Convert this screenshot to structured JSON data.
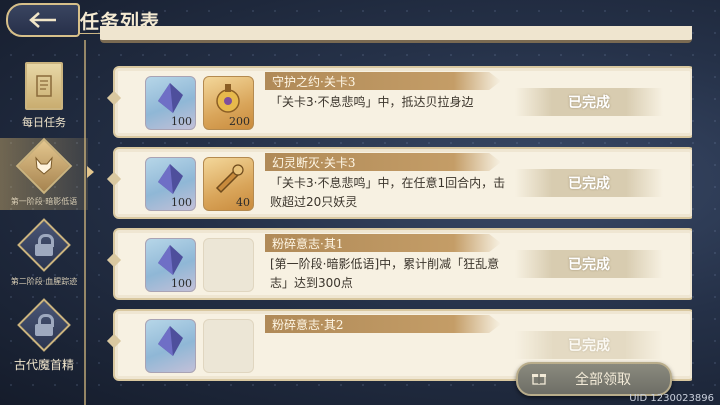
{
  "header": {
    "title": "任务列表"
  },
  "sidebar": {
    "tabs": [
      {
        "label": "每日任务",
        "state": "normal"
      },
      {
        "label": "第一阶段·暗影低语",
        "state": "active"
      },
      {
        "label": "第二阶段·血腥踪迹",
        "state": "locked"
      },
      {
        "label": "古代魔首精",
        "state": "locked"
      }
    ]
  },
  "tasks": [
    {
      "title": "守护之约·关卡3",
      "description": "「关卡3·不息悲鸣」中，抵达贝拉身边",
      "status": "已完成",
      "rewards": [
        {
          "icon": "crystal-icon",
          "qty": "100"
        },
        {
          "icon": "potion-icon",
          "qty": "200"
        }
      ]
    },
    {
      "title": "幻灵断灭·关卡3",
      "description": "「关卡3·不息悲鸣」中，在任意1回合内，击败超过20只妖灵",
      "status": "已完成",
      "rewards": [
        {
          "icon": "crystal-icon",
          "qty": "100"
        },
        {
          "icon": "horn-icon",
          "qty": "40"
        }
      ]
    },
    {
      "title": "粉碎意志·其1",
      "description": "[第一阶段·暗影低语]中，累计削减「狂乱意志」达到300点",
      "status": "已完成",
      "rewards": [
        {
          "icon": "crystal-icon",
          "qty": "100"
        }
      ]
    },
    {
      "title": "粉碎意志·其2",
      "description": "",
      "status": "已完成",
      "rewards": [
        {
          "icon": "crystal-icon",
          "qty": ""
        }
      ]
    }
  ],
  "footer": {
    "claim_all": "全部领取",
    "uid": "UID 1230023896"
  },
  "colors": {
    "accent_gold": "#d7c08a",
    "card_bg": "#f7f1e2",
    "ribbon": "#b08a58"
  }
}
